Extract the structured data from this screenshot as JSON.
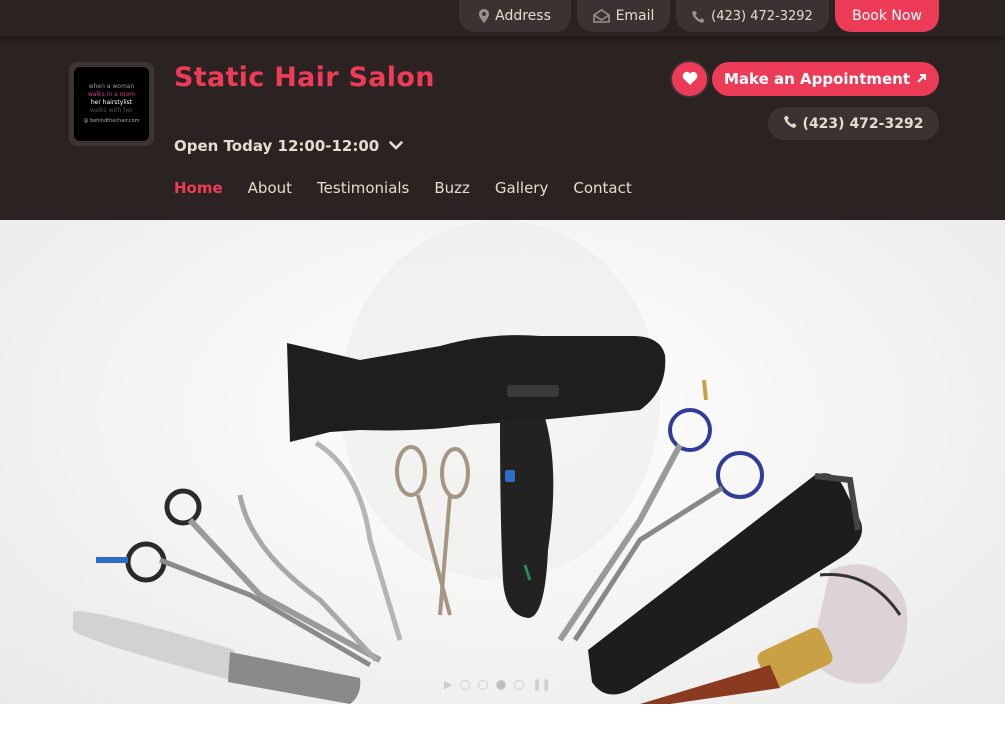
{
  "topbar": {
    "address_label": "Address",
    "email_label": "Email",
    "phone_label": "(423) 472-3292",
    "book_label": "Book Now"
  },
  "logo": {
    "line1": "when a woman",
    "line2": "walks in a room",
    "line3": "her hairstylist",
    "line4": "walks with her",
    "line5": "@ behindthechair.com"
  },
  "header": {
    "title": "Static Hair Salon",
    "hours": "Open Today 12:00-12:00",
    "appointment_label": "Make an Appointment",
    "phone_label": "(423) 472-3292"
  },
  "nav": {
    "items": [
      {
        "label": "Home"
      },
      {
        "label": "About"
      },
      {
        "label": "Testimonials"
      },
      {
        "label": "Buzz"
      },
      {
        "label": "Gallery"
      },
      {
        "label": "Contact"
      }
    ]
  },
  "slider": {
    "slide_count": 4,
    "active_slide": 3
  },
  "colors": {
    "accent": "#ec3b57",
    "header_bg": "#2b2321",
    "pill_bg": "#3a3331",
    "text_light": "#e6dccf"
  },
  "icons": [
    "map-pin-icon",
    "envelope-icon",
    "phone-icon",
    "heart-icon",
    "external-link-icon",
    "chevron-down-icon",
    "play-icon",
    "pause-icon"
  ]
}
